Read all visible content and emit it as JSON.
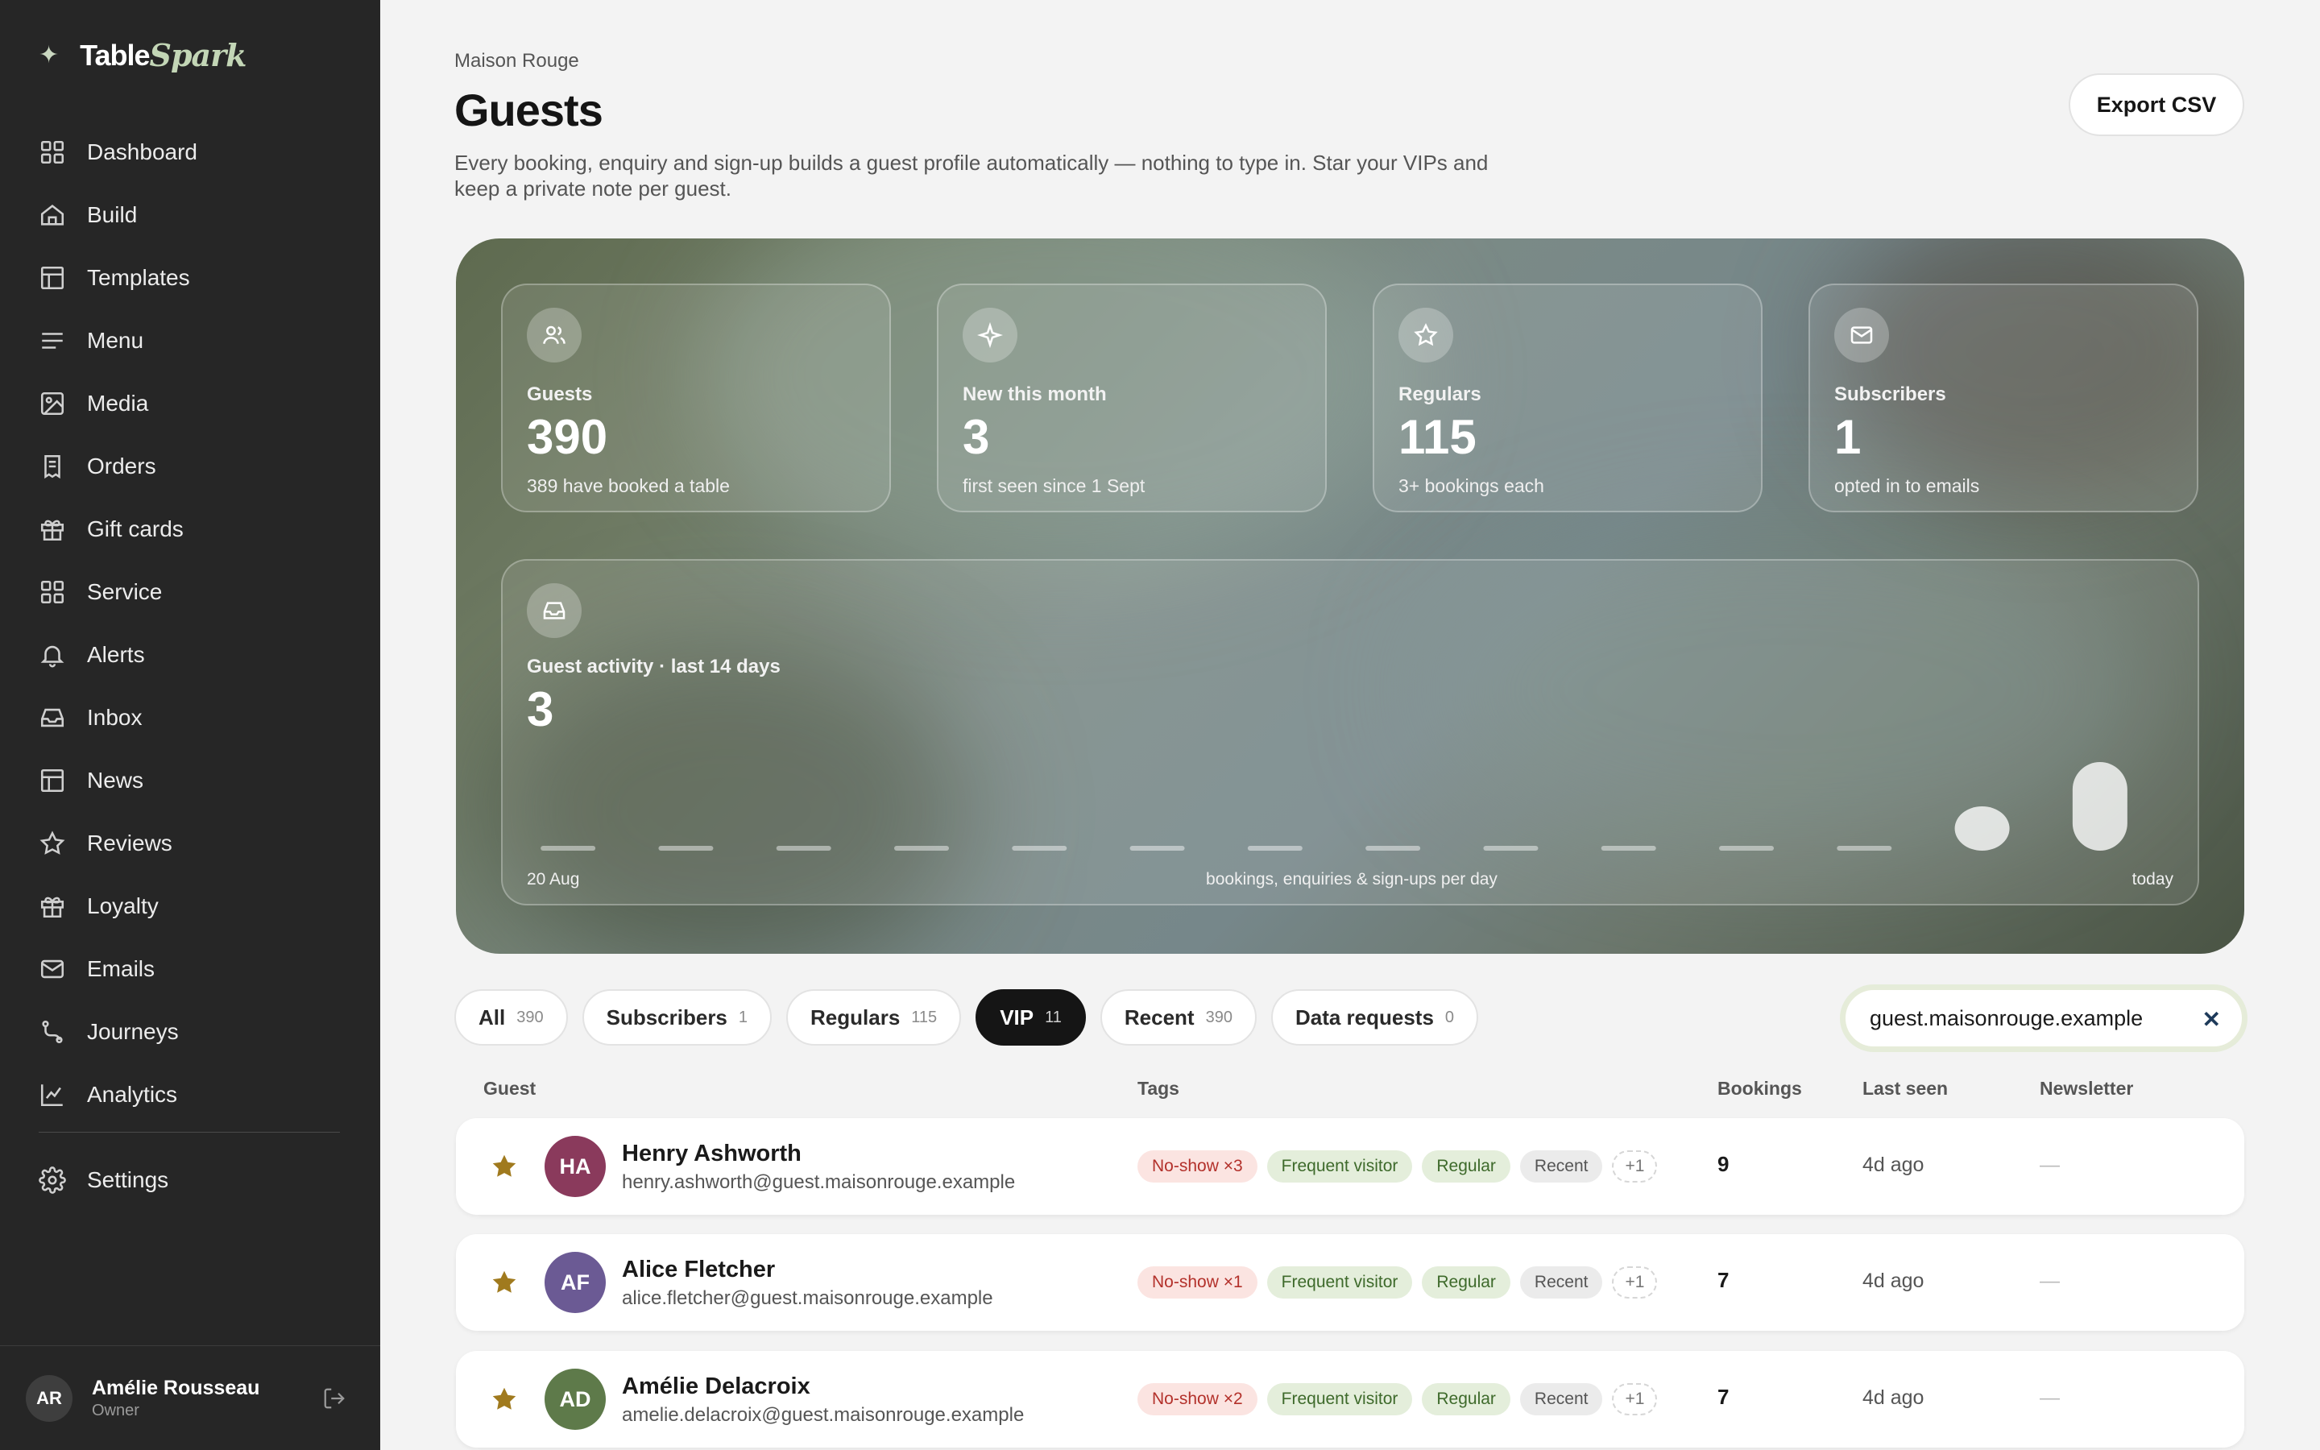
{
  "brand": {
    "mark": "✦",
    "name_a": "Table",
    "name_b": "Spark"
  },
  "nav": [
    {
      "label": "Dashboard",
      "icon": "grid-icon"
    },
    {
      "label": "Build",
      "icon": "home-icon"
    },
    {
      "label": "Templates",
      "icon": "layout-icon"
    },
    {
      "label": "Menu",
      "icon": "lines-icon"
    },
    {
      "label": "Media",
      "icon": "image-icon"
    },
    {
      "label": "Orders",
      "icon": "receipt-icon"
    },
    {
      "label": "Gift cards",
      "icon": "gift-icon"
    },
    {
      "label": "Service",
      "icon": "grid-icon"
    },
    {
      "label": "Alerts",
      "icon": "bell-icon"
    },
    {
      "label": "Inbox",
      "icon": "inbox-icon"
    },
    {
      "label": "News",
      "icon": "layout-icon"
    },
    {
      "label": "Reviews",
      "icon": "star-icon"
    },
    {
      "label": "Loyalty",
      "icon": "gift-icon"
    },
    {
      "label": "Emails",
      "icon": "mail-icon"
    },
    {
      "label": "Journeys",
      "icon": "route-icon"
    },
    {
      "label": "Analytics",
      "icon": "chart-icon"
    }
  ],
  "settings_label": "Settings",
  "user": {
    "initials": "AR",
    "name": "Amélie Rousseau",
    "role": "Owner"
  },
  "header": {
    "breadcrumb": "Maison Rouge",
    "title": "Guests",
    "description": "Every booking, enquiry and sign-up builds a guest profile automatically — nothing to type in. Star your VIPs and keep a private note per guest.",
    "export_label": "Export CSV"
  },
  "stats": [
    {
      "label": "Guests",
      "value": "390",
      "sub": "389 have booked a table",
      "icon": "users-icon"
    },
    {
      "label": "New this month",
      "value": "3",
      "sub": "first seen since 1 Sept",
      "icon": "sparkle-icon"
    },
    {
      "label": "Regulars",
      "value": "115",
      "sub": "3+ bookings each",
      "icon": "star-icon"
    },
    {
      "label": "Subscribers",
      "value": "1",
      "sub": "opted in to emails",
      "icon": "mail-icon"
    }
  ],
  "activity": {
    "label": "Guest activity · last 14 days",
    "value": "3",
    "axis_start": "20 Aug",
    "axis_caption": "bookings, enquiries & sign-ups per day",
    "axis_end": "today",
    "icon": "inbox-icon"
  },
  "chart_data": {
    "type": "bar",
    "values": [
      0,
      0,
      0,
      0,
      0,
      0,
      0,
      0,
      0,
      0,
      0,
      0,
      1,
      2
    ],
    "xlabel": "bookings, enquiries & sign-ups per day"
  },
  "filters": [
    {
      "label": "All",
      "count": "390",
      "active": false
    },
    {
      "label": "Subscribers",
      "count": "1",
      "active": false
    },
    {
      "label": "Regulars",
      "count": "115",
      "active": false
    },
    {
      "label": "VIP",
      "count": "11",
      "active": true
    },
    {
      "label": "Recent",
      "count": "390",
      "active": false
    },
    {
      "label": "Data requests",
      "count": "0",
      "active": false
    }
  ],
  "search": {
    "value": "guest.maisonrouge.example",
    "clear": "✕"
  },
  "columns": {
    "guest": "Guest",
    "tags": "Tags",
    "bookings": "Bookings",
    "last_seen": "Last seen",
    "newsletter": "Newsletter"
  },
  "guests": [
    {
      "initials": "HA",
      "name": "Henry Ashworth",
      "email": "henry.ashworth@guest.maisonrouge.example",
      "avatar_color": "#8a3a5c",
      "tags": [
        "No-show ×3",
        "Frequent visitor",
        "Regular",
        "Recent",
        "+1"
      ],
      "bookings": "9",
      "last_seen": "4d ago",
      "newsletter": "—"
    },
    {
      "initials": "AF",
      "name": "Alice Fletcher",
      "email": "alice.fletcher@guest.maisonrouge.example",
      "avatar_color": "#6b5a94",
      "tags": [
        "No-show ×1",
        "Frequent visitor",
        "Regular",
        "Recent",
        "+1"
      ],
      "bookings": "7",
      "last_seen": "4d ago",
      "newsletter": "—"
    },
    {
      "initials": "AD",
      "name": "Amélie Delacroix",
      "email": "amelie.delacroix@guest.maisonrouge.example",
      "avatar_color": "#5e7a4a",
      "tags": [
        "No-show ×2",
        "Frequent visitor",
        "Regular",
        "Recent",
        "+1"
      ],
      "bookings": "7",
      "last_seen": "4d ago",
      "newsletter": "—"
    }
  ],
  "colors": {
    "sidebar_bg": "#262626",
    "accent_star": "#a07a1e",
    "active_pill": "#151515"
  }
}
